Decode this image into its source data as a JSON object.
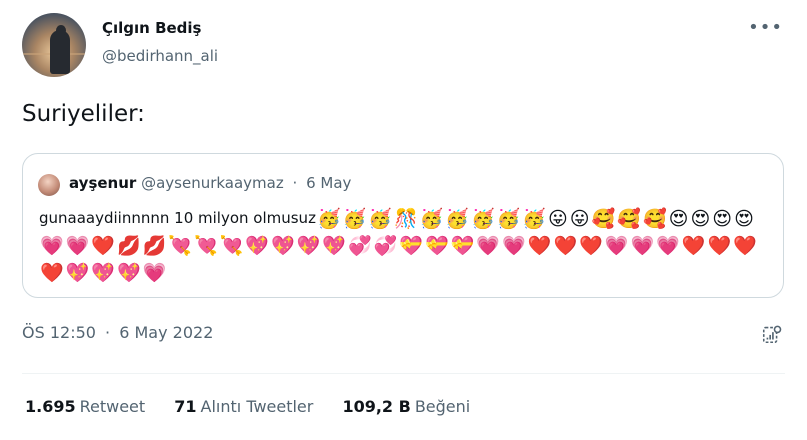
{
  "author": {
    "name": "Çılgın Bediş",
    "handle": "@bedirhann_ali"
  },
  "more_icon": "more-horizontal-icon",
  "tweet": {
    "text": "Suriyeliler:"
  },
  "quoted": {
    "name": "ayşenur",
    "handle": "@aysenurkaaymaz",
    "separator": "·",
    "date": "6 May",
    "text": "gunaaaydiinnnnn 10 milyon olmusuz",
    "emojis": [
      "🥳",
      "🥳",
      "🥳",
      "🎊",
      "🥳",
      "🥳",
      "🥳",
      "🥳",
      "🥳",
      "😛",
      "😛",
      "🥰",
      "🥰",
      "🥰",
      "😍",
      "😍",
      "😍",
      "😍",
      "💗",
      "💗",
      "❤️",
      "💋",
      "💋",
      "💘",
      "💘",
      "💘",
      "💖",
      "💖",
      "💖",
      "💖",
      "💞",
      "💞",
      "💝",
      "💝",
      "💝",
      "💗",
      "💗",
      "❤️",
      "❤️",
      "❤️",
      "💗",
      "💗",
      "💗",
      "❤️",
      "❤️",
      "❤️",
      "❤️",
      "💖",
      "💖",
      "💖",
      "💗"
    ]
  },
  "meta": {
    "time": "ÖS 12:50",
    "separator": "·",
    "date": "6 May 2022"
  },
  "analytics_icon": "analytics-icon",
  "stats": {
    "retweets_count": "1.695",
    "retweets_label": "Retweet",
    "quotes_count": "71",
    "quotes_label": "Alıntı Tweetler",
    "likes_count": "109,2 B",
    "likes_label": "Beğeni"
  }
}
